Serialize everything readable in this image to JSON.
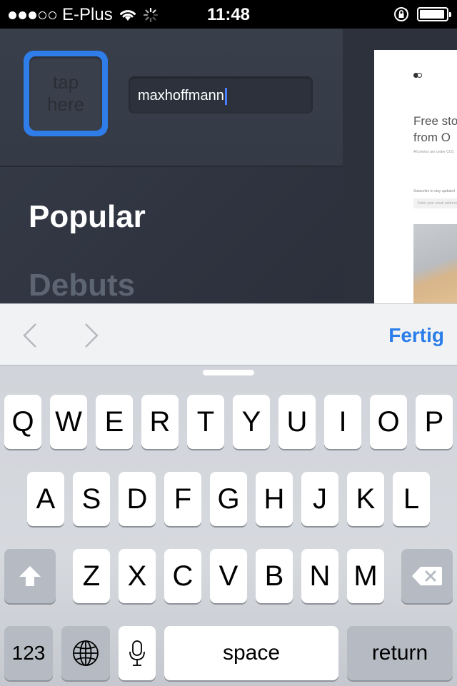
{
  "status_bar": {
    "carrier": "E-Plus",
    "signal_bars": 3,
    "signal_total": 5,
    "time": "11:48",
    "battery_percent": 95,
    "icons": [
      "wifi-icon",
      "activity-spinner-icon",
      "orientation-lock-icon",
      "battery-icon"
    ]
  },
  "profile": {
    "avatar_placeholder": "tap here",
    "username": "maxhoffmann",
    "avatar_border_color": "#2f7de8"
  },
  "nav": {
    "items": [
      {
        "label": "Popular",
        "active": true
      },
      {
        "label": "Debuts",
        "active": false
      }
    ]
  },
  "preview": {
    "headline_line1": "Free sto",
    "headline_line2": "from O",
    "fine_print": "All photos are under CC0.",
    "subscribe_text": "Subscribe to stay updated",
    "email_placeholder": "Enter your email address"
  },
  "accessory_bar": {
    "prev_icon": "chevron-left-icon",
    "next_icon": "chevron-right-icon",
    "done_label": "Fertig",
    "accent_color": "#2b7de9"
  },
  "keyboard": {
    "row1": [
      "Q",
      "W",
      "E",
      "R",
      "T",
      "Y",
      "U",
      "I",
      "O",
      "P"
    ],
    "row2": [
      "A",
      "S",
      "D",
      "F",
      "G",
      "H",
      "J",
      "K",
      "L"
    ],
    "row3": [
      "Z",
      "X",
      "C",
      "V",
      "B",
      "N",
      "M"
    ],
    "numbers_label": "123",
    "space_label": "space",
    "return_label": "return",
    "icons": [
      "shift-icon",
      "delete-icon",
      "globe-icon",
      "microphone-icon"
    ]
  }
}
